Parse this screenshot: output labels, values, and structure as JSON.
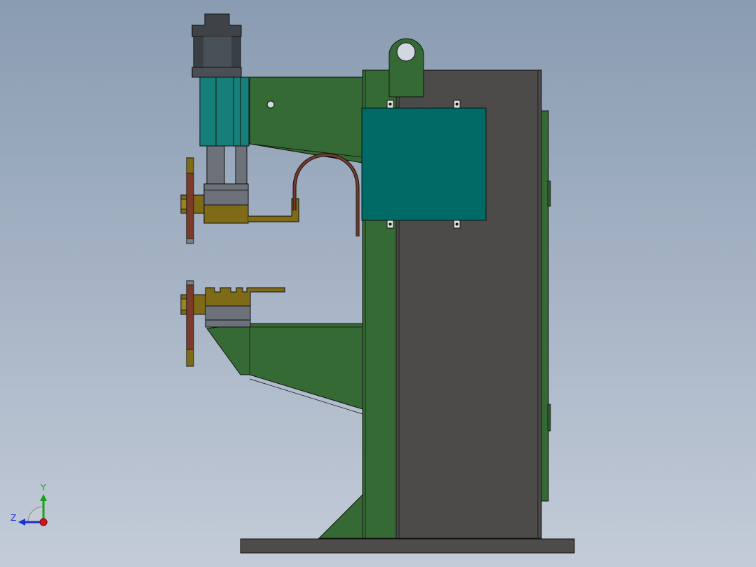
{
  "view": {
    "background_top": "#8a9cb2",
    "background_bottom": "#c3ccd8"
  },
  "model": {
    "name": "spot-welder-machine",
    "colors": {
      "frame_green": "#356a34",
      "frame_green_dark": "#2b5a2b",
      "cabinet_gray": "#4c4b4a",
      "panel_teal": "#006a66",
      "cylinder_teal": "#167f7a",
      "cap_dark": "#3f4247",
      "gray_light": "#8a8e96",
      "brass": "#7f6a17",
      "brass_light": "#9a8324",
      "copper": "#7a3b2a",
      "base_gray": "#4e4c4b"
    }
  },
  "triad": {
    "y_label": "Y",
    "z_label": "Z",
    "y_color": "#1aa11a",
    "z_color": "#1a2fd0",
    "x_color": "#d41414"
  }
}
